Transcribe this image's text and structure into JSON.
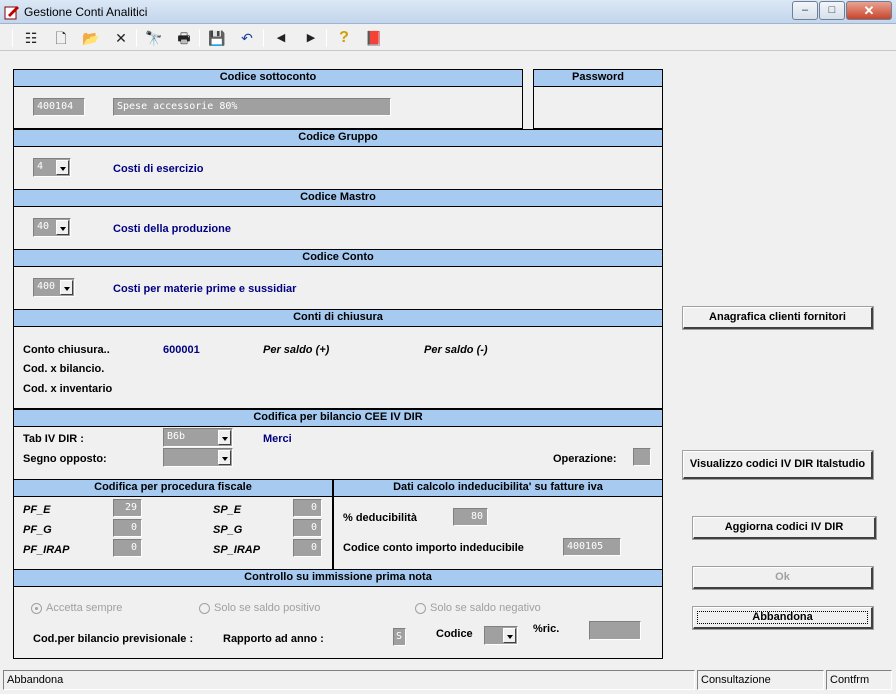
{
  "window": {
    "title": "Gestione Conti Analitici",
    "minimize": "–",
    "maximize": "□",
    "close": "✕"
  },
  "toolbar": {
    "buttons": [
      {
        "name": "list-icon",
        "glyph": "☷"
      },
      {
        "name": "new-document-icon",
        "glyph": "🗋"
      },
      {
        "name": "open-folder-icon",
        "glyph": "📂"
      },
      {
        "name": "delete-icon",
        "glyph": "✕"
      },
      {
        "name": "search-icon",
        "glyph": "🔭"
      },
      {
        "name": "print-preview-icon",
        "glyph": "🖶"
      },
      {
        "name": "save-icon",
        "glyph": "💾"
      },
      {
        "name": "undo-icon",
        "glyph": "↶"
      },
      {
        "name": "previous-icon",
        "glyph": "◀"
      },
      {
        "name": "next-icon",
        "glyph": "▶"
      },
      {
        "name": "help-icon",
        "glyph": "?"
      },
      {
        "name": "book-icon",
        "glyph": "📕"
      }
    ]
  },
  "sottoconto": {
    "header": "Codice sottoconto",
    "code": "400104",
    "description": "Spese accessorie 80%"
  },
  "password": {
    "header": "Password"
  },
  "gruppo": {
    "header": "Codice Gruppo",
    "value": "4",
    "description": "Costi di esercizio"
  },
  "mastro": {
    "header": "Codice Mastro",
    "value": "40",
    "description": "Costi della produzione"
  },
  "conto": {
    "header": "Codice Conto",
    "value": "400",
    "description": "Costi per materie prime e sussidiar"
  },
  "chiusura": {
    "header": "Conti di chiusura",
    "conto_label": "Conto chiusura..",
    "conto_value": "600001",
    "saldo_pos": "Per saldo (+)",
    "saldo_neg": "Per saldo (-)",
    "bilancio_label": "Cod. x bilancio.",
    "inventario_label": "Cod. x inventario"
  },
  "cee": {
    "header": "Codifica per bilancio CEE IV DIR",
    "tab_label": "Tab IV DIR   :",
    "tab_value": "B6b",
    "tab_description": "Merci",
    "segno_label": "Segno opposto:",
    "segno_value": "",
    "operazione_label": "Operazione:"
  },
  "fiscale": {
    "header": "Codifica per procedura fiscale",
    "pf_e_label": "PF_E",
    "pf_e_value": "29",
    "pf_g_label": "PF_G",
    "pf_g_value": "0",
    "pf_irap_label": "PF_IRAP",
    "pf_irap_value": "0",
    "sp_e_label": "SP_E",
    "sp_e_value": "0",
    "sp_g_label": "SP_G",
    "sp_g_value": "0",
    "sp_irap_label": "SP_IRAP",
    "sp_irap_value": "0"
  },
  "indeducibilita": {
    "header": "Dati calcolo indeducibilita' su fatture iva",
    "deducibilita_label": "% deducibilità",
    "deducibilita_value": "80",
    "codice_label": "Codice conto importo indeducibile",
    "codice_value": "400105"
  },
  "primanota": {
    "header": "Controllo su immissione prima nota",
    "radio1": "Accetta sempre",
    "radio2": "Solo se saldo positivo",
    "radio3": "Solo se saldo negativo",
    "previsionale_label": "Cod.per bilancio previsionale :",
    "rapporto_label": "Rapporto ad anno :",
    "rapporto_value": "S",
    "codice_label": "Codice",
    "codice_value": "",
    "ric_label": "%ric.",
    "ric_value": ""
  },
  "side_buttons": {
    "anagrafica": "Anagrafica clienti fornitori",
    "visualizzo": "Visualizzo codici IV DIR  Italstudio",
    "aggiorna": "Aggiorna codici IV DIR",
    "ok": "Ok",
    "abbandona": "Abbandona"
  },
  "status": {
    "left": "Abbandona",
    "mode": "Consultazione",
    "confirm": "Contfrm"
  }
}
